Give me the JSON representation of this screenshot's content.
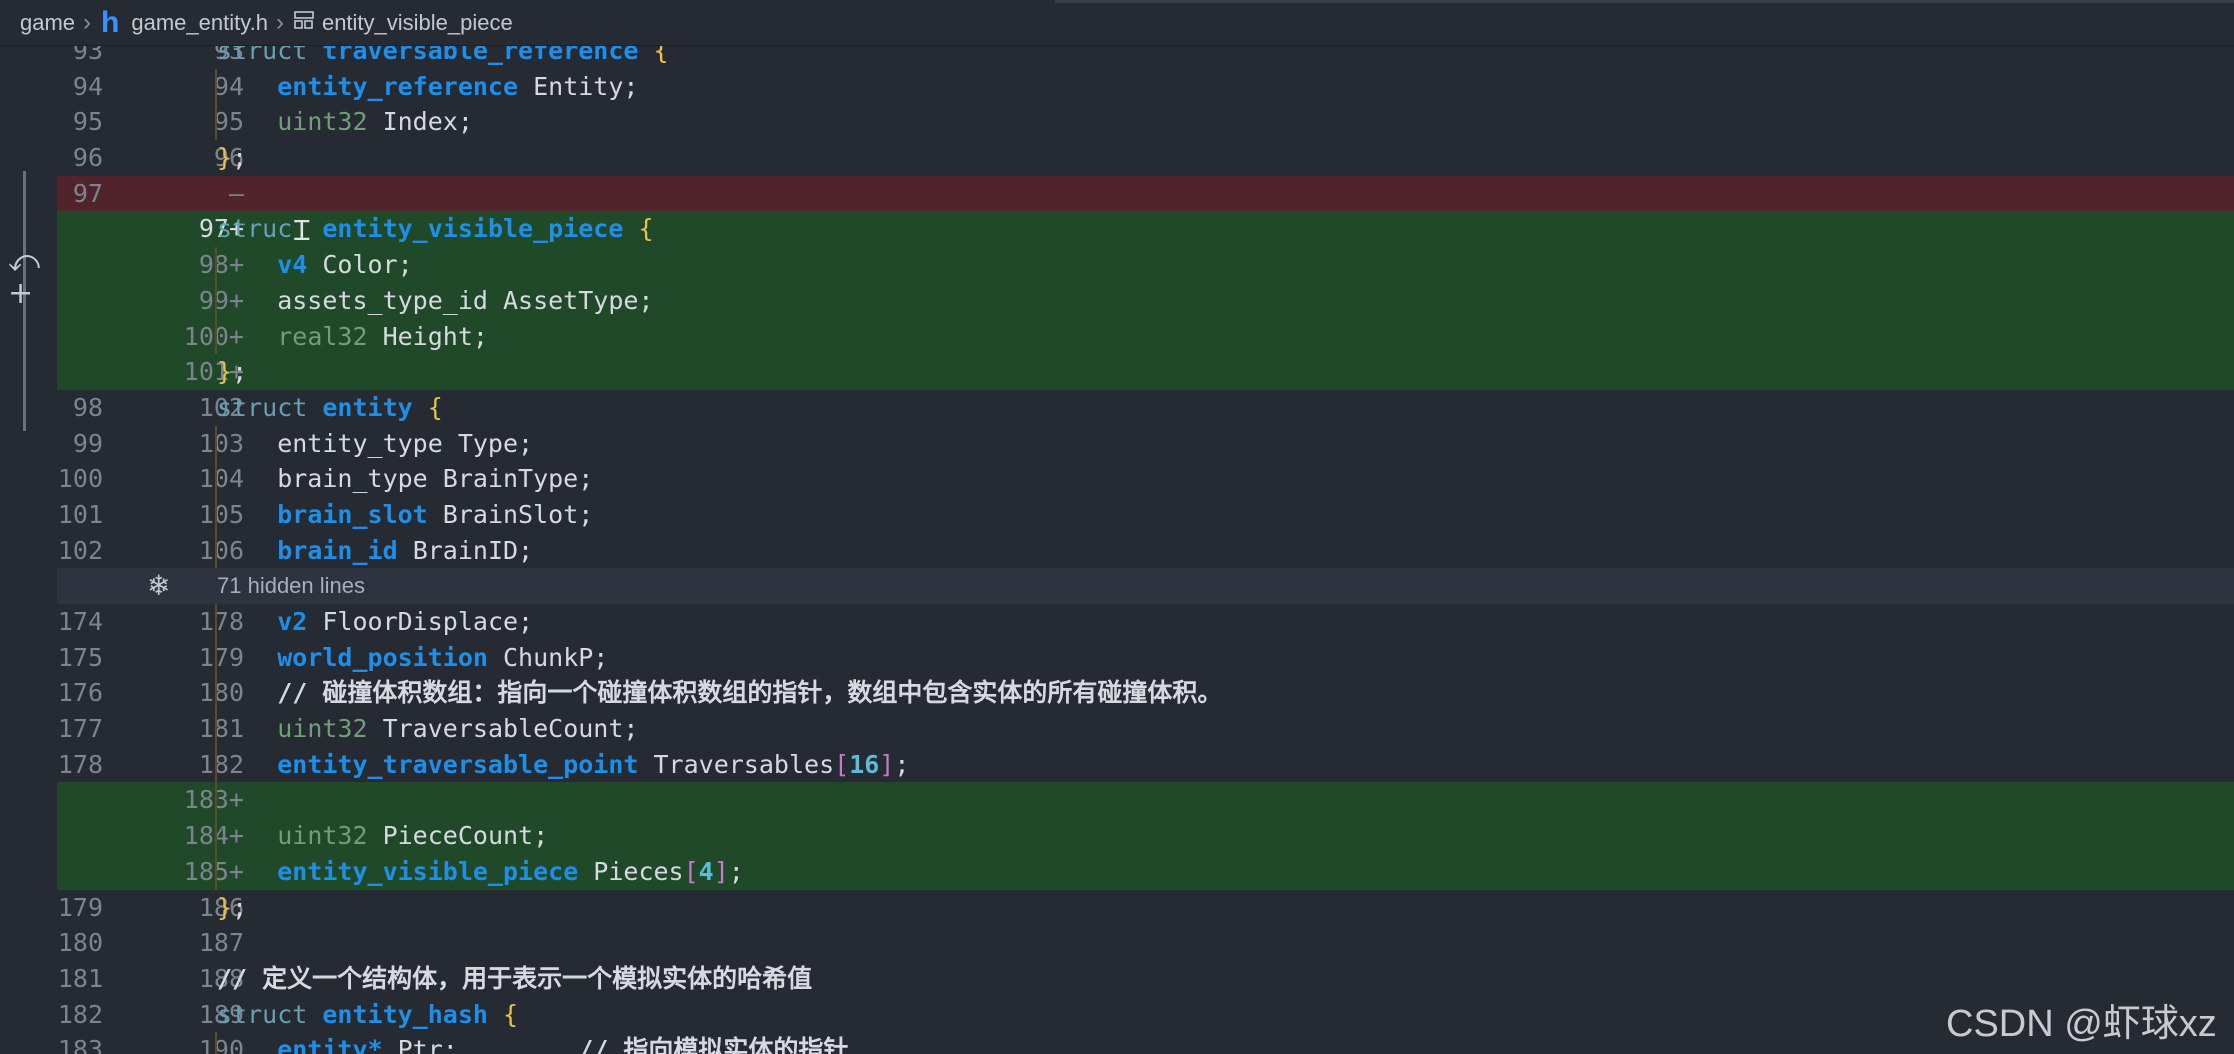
{
  "breadcrumb": {
    "folder": "game",
    "file_icon": "h",
    "file": "game_entity.h",
    "symbol": "entity_visible_piece"
  },
  "gutter_icons": [
    "revert-icon",
    "add-icon"
  ],
  "fold": {
    "text": "71 hidden lines"
  },
  "watermark": "CSDN @虾球xz",
  "rows": [
    {
      "old": "93",
      "new": "93",
      "type": "ctx",
      "tokens": [
        [
          "k-struct",
          "struct "
        ],
        [
          "k-type",
          "traversable_reference "
        ],
        [
          "k-brace",
          "{"
        ]
      ]
    },
    {
      "old": "94",
      "new": "94",
      "type": "ctx",
      "tokens": [
        [
          "k-plain",
          "    "
        ],
        [
          "k-type",
          "entity_reference"
        ],
        [
          "k-plain",
          " Entity;"
        ]
      ]
    },
    {
      "old": "95",
      "new": "95",
      "type": "ctx",
      "tokens": [
        [
          "k-plain",
          "    "
        ],
        [
          "k-prim",
          "uint32"
        ],
        [
          "k-plain",
          " Index;"
        ]
      ]
    },
    {
      "old": "96",
      "new": "96",
      "type": "ctx",
      "tokens": [
        [
          "k-brace",
          "}"
        ],
        [
          "k-plain",
          ";"
        ]
      ]
    },
    {
      "old": "97",
      "new": "—",
      "type": "removed",
      "tokens": []
    },
    {
      "old": "",
      "new": "97+",
      "type": "added",
      "active": true,
      "tokens": [
        [
          "k-struct",
          "struc"
        ],
        [
          "k-plain",
          "  "
        ],
        [
          "k-type",
          "entity_visible_piece "
        ],
        [
          "k-brace",
          "{"
        ]
      ]
    },
    {
      "old": "",
      "new": "98+",
      "type": "added",
      "tokens": [
        [
          "k-plain",
          "    "
        ],
        [
          "k-type",
          "v4"
        ],
        [
          "k-plain",
          " Color;"
        ]
      ]
    },
    {
      "old": "",
      "new": "99+",
      "type": "added",
      "tokens": [
        [
          "k-plain",
          "    assets_type_id AssetType;"
        ]
      ]
    },
    {
      "old": "",
      "new": "100+",
      "type": "added",
      "tokens": [
        [
          "k-plain",
          "    "
        ],
        [
          "k-prim",
          "real32"
        ],
        [
          "k-plain",
          " Height;"
        ]
      ]
    },
    {
      "old": "",
      "new": "101+",
      "type": "added",
      "tokens": [
        [
          "k-brace",
          "}"
        ],
        [
          "k-plain",
          ";"
        ]
      ]
    },
    {
      "old": "98",
      "new": "102",
      "type": "ctx",
      "tokens": [
        [
          "k-struct",
          "struct "
        ],
        [
          "k-type",
          "entity "
        ],
        [
          "k-brace",
          "{"
        ]
      ]
    },
    {
      "old": "99",
      "new": "103",
      "type": "ctx",
      "tokens": [
        [
          "k-plain",
          "    entity_type Type;"
        ]
      ]
    },
    {
      "old": "100",
      "new": "104",
      "type": "ctx",
      "tokens": [
        [
          "k-plain",
          "    brain_type BrainType;"
        ]
      ]
    },
    {
      "old": "101",
      "new": "105",
      "type": "ctx",
      "tokens": [
        [
          "k-plain",
          "    "
        ],
        [
          "k-type",
          "brain_slot"
        ],
        [
          "k-plain",
          " BrainSlot;"
        ]
      ]
    },
    {
      "old": "102",
      "new": "106",
      "type": "ctx",
      "tokens": [
        [
          "k-plain",
          "    "
        ],
        [
          "k-type",
          "brain_id"
        ],
        [
          "k-plain",
          " BrainID;"
        ]
      ]
    },
    {
      "old": "",
      "new": "",
      "type": "fold",
      "tokens": []
    },
    {
      "old": "174",
      "new": "178",
      "type": "ctx",
      "tokens": [
        [
          "k-plain",
          "    "
        ],
        [
          "k-type",
          "v2"
        ],
        [
          "k-plain",
          " FloorDisplace;"
        ]
      ]
    },
    {
      "old": "175",
      "new": "179",
      "type": "ctx",
      "tokens": [
        [
          "k-plain",
          "    "
        ],
        [
          "k-type",
          "world_position"
        ],
        [
          "k-plain",
          " ChunkP;"
        ]
      ]
    },
    {
      "old": "176",
      "new": "180",
      "type": "ctx",
      "tokens": [
        [
          "k-comment",
          "    // 碰撞体积数组：指向一个碰撞体积数组的指针，数组中包含实体的所有碰撞体积。"
        ]
      ]
    },
    {
      "old": "177",
      "new": "181",
      "type": "ctx",
      "tokens": [
        [
          "k-plain",
          "    "
        ],
        [
          "k-prim",
          "uint32"
        ],
        [
          "k-plain",
          " TraversableCount;"
        ]
      ]
    },
    {
      "old": "178",
      "new": "182",
      "type": "ctx",
      "tokens": [
        [
          "k-plain",
          "    "
        ],
        [
          "k-type",
          "entity_traversable_point"
        ],
        [
          "k-plain",
          " Traversables"
        ],
        [
          "k-bracket",
          "["
        ],
        [
          "k-num",
          "16"
        ],
        [
          "k-bracket",
          "]"
        ],
        [
          "k-plain",
          ";"
        ]
      ]
    },
    {
      "old": "",
      "new": "183+",
      "type": "added",
      "tokens": []
    },
    {
      "old": "",
      "new": "184+",
      "type": "added",
      "tokens": [
        [
          "k-plain",
          "    "
        ],
        [
          "k-prim",
          "uint32"
        ],
        [
          "k-plain",
          " PieceCount;"
        ]
      ]
    },
    {
      "old": "",
      "new": "185+",
      "type": "added",
      "tokens": [
        [
          "k-plain",
          "    "
        ],
        [
          "k-type",
          "entity_visible_piece"
        ],
        [
          "k-plain",
          " Pieces"
        ],
        [
          "k-bracket",
          "["
        ],
        [
          "k-num",
          "4"
        ],
        [
          "k-bracket",
          "]"
        ],
        [
          "k-plain",
          ";"
        ]
      ]
    },
    {
      "old": "179",
      "new": "186",
      "type": "ctx",
      "tokens": [
        [
          "k-brace",
          "}"
        ],
        [
          "k-plain",
          ";"
        ]
      ]
    },
    {
      "old": "180",
      "new": "187",
      "type": "ctx",
      "tokens": []
    },
    {
      "old": "181",
      "new": "188",
      "type": "ctx",
      "tokens": [
        [
          "k-comment",
          "// 定义一个结构体，用于表示一个模拟实体的哈希值"
        ]
      ]
    },
    {
      "old": "182",
      "new": "189",
      "type": "ctx",
      "tokens": [
        [
          "k-struct",
          "struct "
        ],
        [
          "k-type",
          "entity_hash "
        ],
        [
          "k-brace",
          "{"
        ]
      ]
    },
    {
      "old": "183",
      "new": "190",
      "type": "ctx",
      "tokens": [
        [
          "k-plain",
          "    "
        ],
        [
          "k-type",
          "entity*"
        ],
        [
          "k-plain",
          " Ptr;        "
        ],
        [
          "k-comment",
          "// 指向模拟实体的指针"
        ]
      ]
    }
  ]
}
